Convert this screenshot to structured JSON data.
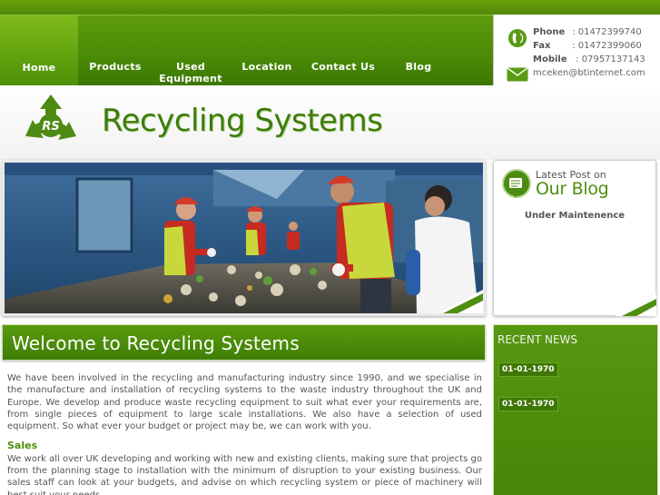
{
  "nav": {
    "items": [
      {
        "label": "Home"
      },
      {
        "label": "Products"
      },
      {
        "label": "Used Equipment"
      },
      {
        "label": "Location"
      },
      {
        "label": "Contact Us"
      },
      {
        "label": "Blog"
      }
    ]
  },
  "contact": {
    "phone_label": "Phone",
    "phone": ": 01472399740",
    "fax_label": "Fax",
    "fax": ": 01472399060",
    "mobile_label": "Mobile",
    "mobile": ": 07957137143",
    "email": "mceken@btinternet.com"
  },
  "brand": {
    "logo_mark": "RS",
    "name": "Recycling Systems"
  },
  "blog": {
    "kicker": "Latest Post on",
    "title": "Our Blog",
    "status": "Under Maintenence"
  },
  "welcome": {
    "title": "Welcome to Recycling Systems",
    "intro": "We have been involved in the recycling and manufacturing industry since 1990, and we specialise in the manufacture and installation of recycling systems to the waste industry throughout the UK and Europe. We develop and produce waste recycling equipment to suit what ever your requirements are, from single pieces of equipment to large scale installations. We also have a selection of used equipment. So what ever your budget or project may be, we can work with you.",
    "sales_heading": "Sales",
    "sales_text": "We work all over UK developing and working with new and existing clients, making sure that projects go from the planning stage to installation with the minimum of disruption to your existing business. Our sales staff can look at your budgets, and advise on which recycling system or piece of machinery will best suit your needs."
  },
  "news": {
    "title": "RECENT NEWS",
    "items": [
      {
        "date": "01-01-1970"
      },
      {
        "date": "01-01-1970"
      }
    ]
  },
  "icons": {
    "phone": "phone-icon",
    "mail": "mail-icon",
    "logo": "recycle-logo-icon",
    "blog": "blog-badge-icon"
  },
  "colors": {
    "brand_green": "#4a8a06",
    "nav_active": "#7fb91c",
    "text_grey": "#555555"
  }
}
